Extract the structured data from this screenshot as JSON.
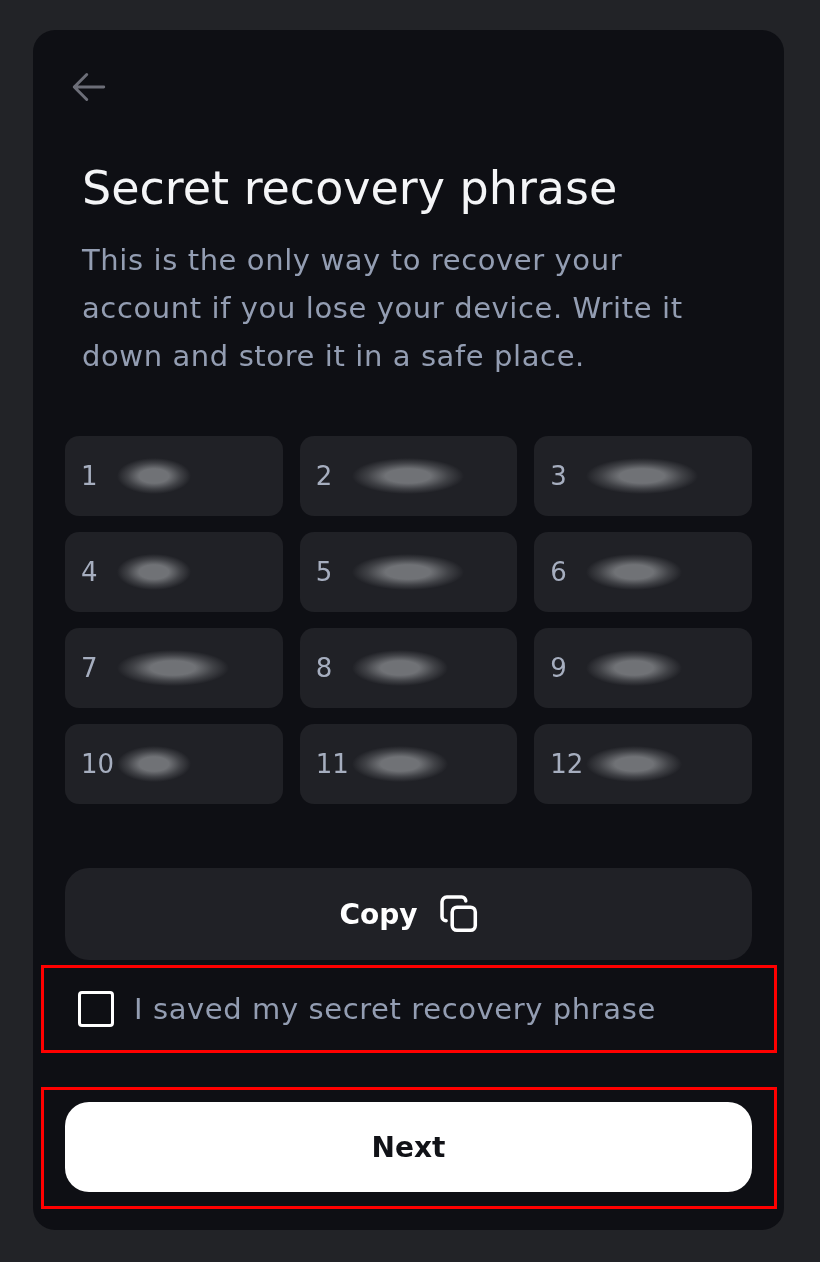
{
  "header": {
    "title": "Secret recovery phrase",
    "description": "This is the only way to recover your account if you lose your device. Write it down and store it in a safe place."
  },
  "phrase": {
    "words": [
      {
        "number": "1"
      },
      {
        "number": "2"
      },
      {
        "number": "3"
      },
      {
        "number": "4"
      },
      {
        "number": "5"
      },
      {
        "number": "6"
      },
      {
        "number": "7"
      },
      {
        "number": "8"
      },
      {
        "number": "9"
      },
      {
        "number": "10"
      },
      {
        "number": "11"
      },
      {
        "number": "12"
      }
    ]
  },
  "copy_button": {
    "label": "Copy"
  },
  "consent": {
    "label": "I saved my secret recovery phrase",
    "checked": false,
    "highlighted": true
  },
  "next_button": {
    "label": "Next",
    "highlighted": true
  }
}
